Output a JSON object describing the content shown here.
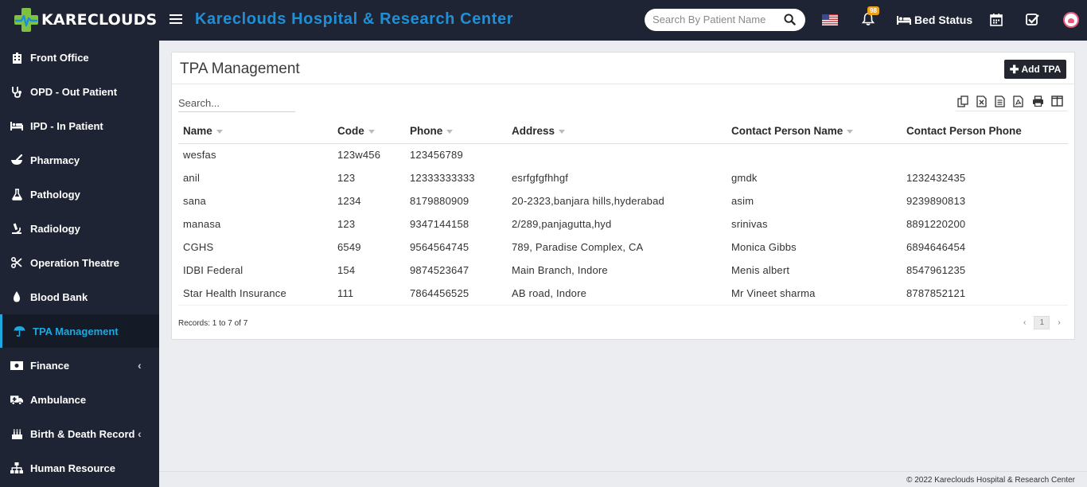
{
  "header": {
    "logo_text": "KARECLOUDS",
    "app_title": "Kareclouds Hospital & Research Center",
    "search_placeholder": "Search By Patient Name",
    "notification_count": "98",
    "bed_status_label": "Bed Status"
  },
  "sidebar": {
    "items": [
      {
        "label": "Front Office",
        "icon": "building-icon"
      },
      {
        "label": "OPD - Out Patient",
        "icon": "stethoscope-icon"
      },
      {
        "label": "IPD - In Patient",
        "icon": "bed-icon"
      },
      {
        "label": "Pharmacy",
        "icon": "mortar-pestle-icon"
      },
      {
        "label": "Pathology",
        "icon": "flask-icon"
      },
      {
        "label": "Radiology",
        "icon": "microscope-icon"
      },
      {
        "label": "Operation Theatre",
        "icon": "scissors-icon"
      },
      {
        "label": "Blood Bank",
        "icon": "tint-icon"
      },
      {
        "label": "TPA Management",
        "icon": "umbrella-icon",
        "active": true
      },
      {
        "label": "Finance",
        "icon": "money-icon",
        "submenu": true
      },
      {
        "label": "Ambulance",
        "icon": "ambulance-icon"
      },
      {
        "label": "Birth & Death Record",
        "icon": "birthday-cake-icon",
        "submenu": true
      },
      {
        "label": "Human Resource",
        "icon": "sitemap-icon"
      }
    ]
  },
  "main": {
    "title": "TPA Management",
    "add_button_label": "Add TPA",
    "table_search_placeholder": "Search...",
    "columns": [
      "Name",
      "Code",
      "Phone",
      "Address",
      "Contact Person Name",
      "Contact Person Phone"
    ],
    "rows": [
      [
        "wesfas",
        "123w456",
        "123456789",
        "",
        "",
        ""
      ],
      [
        "anil",
        "123",
        "12333333333",
        "esrfgfgfhhgf",
        "gmdk",
        "1232432435"
      ],
      [
        "sana",
        "1234",
        "8179880909",
        "20-2323,banjara hills,hyderabad",
        "asim",
        "9239890813"
      ],
      [
        "manasa",
        "123",
        "9347144158",
        "2/289,panjagutta,hyd",
        "srinivas",
        "8891220200"
      ],
      [
        "CGHS",
        "6549",
        "9564564745",
        "789, Paradise Complex, CA",
        "Monica Gibbs",
        "6894646454"
      ],
      [
        "IDBI Federal",
        "154",
        "9874523647",
        "Main Branch, Indore",
        "Menis albert",
        "8547961235"
      ],
      [
        "Star Health Insurance",
        "111",
        "7864456525",
        "AB road, Indore",
        "Mr Vineet sharma",
        "8787852121"
      ]
    ],
    "records_text": "Records: 1 to 7 of 7",
    "current_page": "1",
    "prev_glyph": "‹",
    "next_glyph": "›"
  },
  "footer": {
    "copyright": "© 2022 Kareclouds Hospital & Research Center"
  },
  "colors": {
    "topbar_bg": "#1e2433",
    "accent": "#1f8fd6",
    "active_nav": "#1fa8e0",
    "logo_green": "#7dc242",
    "badge": "#f0a11a"
  }
}
